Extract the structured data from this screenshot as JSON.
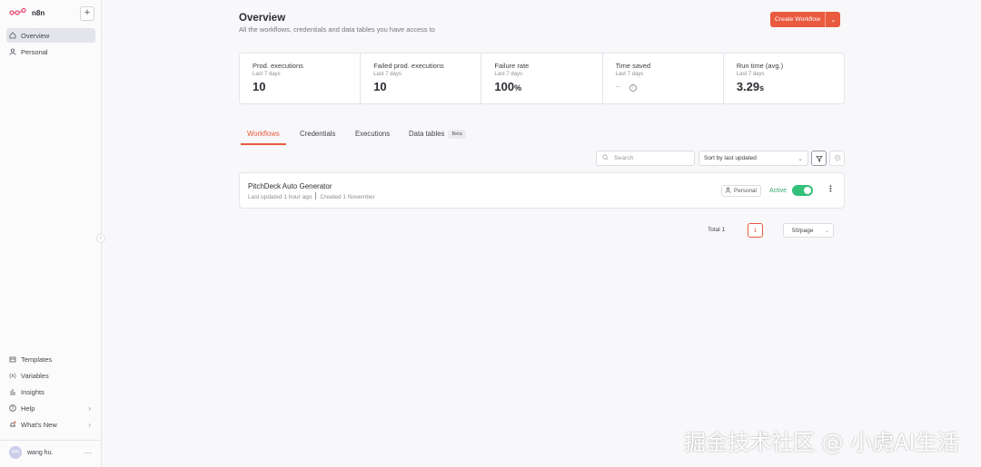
{
  "app": {
    "name": "n8n"
  },
  "sidebar": {
    "items": [
      {
        "label": "Overview",
        "icon": "home-icon"
      },
      {
        "label": "Personal",
        "icon": "user-icon"
      }
    ],
    "bottom_items": [
      {
        "label": "Templates",
        "icon": "box-icon"
      },
      {
        "label": "Variables",
        "icon": "variable-icon"
      },
      {
        "label": "Insights",
        "icon": "chart-icon"
      },
      {
        "label": "Help",
        "icon": "help-circle-icon"
      },
      {
        "label": "What's New",
        "icon": "bell-icon"
      }
    ],
    "user": {
      "initials": "WH",
      "name": "wang hu."
    }
  },
  "header": {
    "title": "Overview",
    "subtitle": "All the workflows, credentials and data tables you have access to",
    "create_label": "Create Workflow"
  },
  "stats": [
    {
      "label": "Prod. executions",
      "period": "Last 7 days",
      "value": "10",
      "unit": ""
    },
    {
      "label": "Failed prod. executions",
      "period": "Last 7 days",
      "value": "10",
      "unit": ""
    },
    {
      "label": "Failure rate",
      "period": "Last 7 days",
      "value": "100",
      "unit": "%"
    },
    {
      "label": "Time saved",
      "period": "Last 7 days",
      "value": "--",
      "unit": ""
    },
    {
      "label": "Run time (avg.)",
      "period": "Last 7 days",
      "value": "3.29",
      "unit": "s"
    }
  ],
  "tabs": [
    {
      "label": "Workflows"
    },
    {
      "label": "Credentials"
    },
    {
      "label": "Executions"
    },
    {
      "label": "Data tables",
      "badge": "Beta"
    }
  ],
  "toolbar": {
    "search_placeholder": "Search",
    "sort_value": "Sort by last updated"
  },
  "workflows": [
    {
      "name": "PitchDeck Auto Generator",
      "updated": "Last updated 1 hour ago",
      "created": "Created 1 November",
      "owner": "Personal",
      "status": "Active"
    }
  ],
  "pagination": {
    "total": "Total 1",
    "page": "1",
    "page_size": "50/page"
  },
  "watermark": "掘金技术社区 @ 小虎AI生活",
  "colors": {
    "accent": "#ea5a3f",
    "active_green": "#33c07a"
  }
}
